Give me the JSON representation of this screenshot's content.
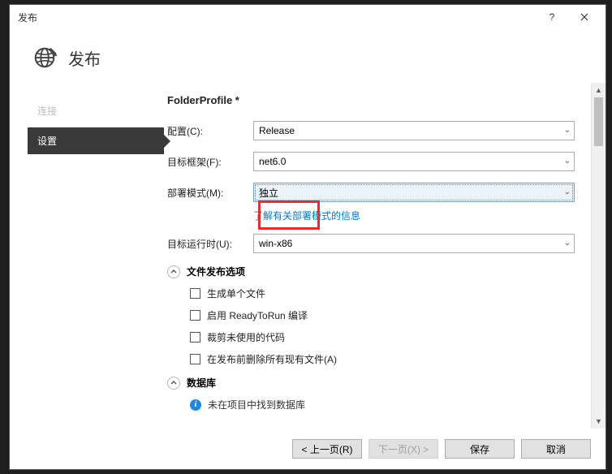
{
  "window": {
    "title": "发布"
  },
  "header": {
    "title": "发布"
  },
  "sidebar": {
    "link": "连接",
    "active": "设置"
  },
  "form": {
    "profile_title": "FolderProfile *",
    "config_label": "配置(C):",
    "config_value": "Release",
    "framework_label": "目标框架(F):",
    "framework_value": "net6.0",
    "deploy_label": "部署模式(M):",
    "deploy_value": "独立",
    "deploy_info_link": "了解有关部署模式的信息",
    "runtime_label": "目标运行时(U):",
    "runtime_value": "win-x86"
  },
  "file_options": {
    "section_title": "文件发布选项",
    "items": [
      "生成单个文件",
      "启用 ReadyToRun 编译",
      "裁剪未使用的代码",
      "在发布前删除所有现有文件(A)"
    ]
  },
  "db": {
    "section_title": "数据库",
    "message": "未在项目中找到数据库"
  },
  "footer": {
    "prev": "< 上一页(R)",
    "next": "下一页(X) >",
    "save": "保存",
    "cancel": "取消"
  }
}
